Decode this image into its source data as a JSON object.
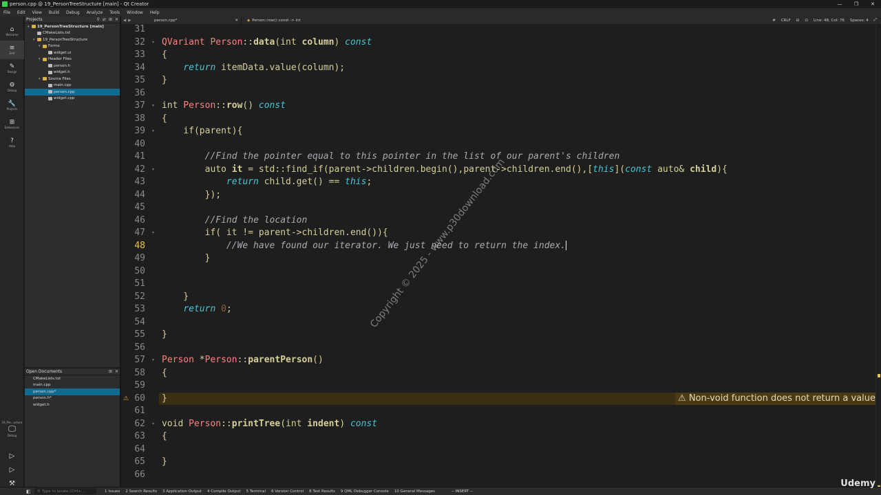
{
  "window": {
    "title": "person.cpp @ 19_PersonTreeStructure [main] - Qt Creator"
  },
  "menu": [
    "File",
    "Edit",
    "View",
    "Build",
    "Debug",
    "Analyze",
    "Tools",
    "Window",
    "Help"
  ],
  "modes": [
    {
      "label": "Welcome",
      "icon": "welcome-icon",
      "glyph": "⌂"
    },
    {
      "label": "Edit",
      "icon": "edit-icon",
      "glyph": "≡"
    },
    {
      "label": "Design",
      "icon": "design-icon",
      "glyph": "✎"
    },
    {
      "label": "Debug",
      "icon": "debug-icon",
      "glyph": "⚙"
    },
    {
      "label": "Projects",
      "icon": "projects-icon",
      "glyph": "🔧"
    },
    {
      "label": "Extensions",
      "icon": "extensions-icon",
      "glyph": "⊞"
    },
    {
      "label": "Help",
      "icon": "help-icon",
      "glyph": "?"
    }
  ],
  "kit": {
    "name": "19_Per...ucture",
    "mode": "Debug"
  },
  "projects_pane": {
    "title": "Projects",
    "items": [
      {
        "label": "19_PersonTreeStructure [main]",
        "indent": 0,
        "kind": "project",
        "bold": true
      },
      {
        "label": "CMakeLists.txt",
        "indent": 1,
        "kind": "file"
      },
      {
        "label": "19_PersonTreeStructure",
        "indent": 1,
        "kind": "folder"
      },
      {
        "label": "Forms",
        "indent": 2,
        "kind": "folder"
      },
      {
        "label": "widget.ui",
        "indent": 3,
        "kind": "file"
      },
      {
        "label": "Header Files",
        "indent": 2,
        "kind": "folder"
      },
      {
        "label": "person.h",
        "indent": 3,
        "kind": "file"
      },
      {
        "label": "widget.h",
        "indent": 3,
        "kind": "file"
      },
      {
        "label": "Source Files",
        "indent": 2,
        "kind": "folder"
      },
      {
        "label": "main.cpp",
        "indent": 3,
        "kind": "file"
      },
      {
        "label": "person.cpp",
        "indent": 3,
        "kind": "file",
        "selected": true
      },
      {
        "label": "widget.cpp",
        "indent": 3,
        "kind": "file"
      }
    ]
  },
  "open_documents": {
    "title": "Open Documents",
    "items": [
      {
        "label": "CMakeLists.txt"
      },
      {
        "label": "main.cpp"
      },
      {
        "label": "person.cpp*",
        "selected": true
      },
      {
        "label": "person.h*"
      },
      {
        "label": "widget.h"
      }
    ]
  },
  "editor_toolbar": {
    "file": "person.cpp*",
    "symbol": "Person::row() const -> int",
    "line_ending": "CRLF",
    "position": "Line: 48, Col: 76",
    "indent": "Spaces: 4"
  },
  "code": {
    "current_line": 48,
    "warning": {
      "line": 60,
      "text": "⚠ Non-void function does not return a value"
    },
    "lines": [
      {
        "n": 31,
        "html": ""
      },
      {
        "n": 32,
        "html": "<span class='ty'>QVariant</span> <span class='ty'>Person</span>::<span class='fn'>data</span>(<span class='kw'>int</span> <span class='bold'>column</span>) <span class='kwi'>const</span>"
      },
      {
        "n": 33,
        "html": "{"
      },
      {
        "n": 34,
        "html": "    <span class='kwi'>return</span> itemData.value(column);"
      },
      {
        "n": 35,
        "html": "}"
      },
      {
        "n": 36,
        "html": ""
      },
      {
        "n": 37,
        "html": "<span class='kw'>int</span> <span class='ty'>Person</span>::<span class='fn'>row</span>() <span class='kwi'>const</span>"
      },
      {
        "n": 38,
        "html": "{"
      },
      {
        "n": 39,
        "html": "    <span class='kw'>if</span>(parent){"
      },
      {
        "n": 40,
        "html": ""
      },
      {
        "n": 41,
        "html": "        <span class='cm'>//Find the pointer equal to this pointer in the list of our parent's children</span>"
      },
      {
        "n": 42,
        "html": "        <span class='kw'>auto</span> <span class='bold'>it</span> = std::find_if(parent-&gt;children.begin(),parent-&gt;children.end(),[<span class='kwi'>this</span>](<span class='kwi'>const</span> <span class='kw'>auto</span>&amp; <span class='bold'>child</span>){"
      },
      {
        "n": 43,
        "html": "            <span class='kwi'>return</span> child.get() == <span class='kwi'>this</span>;"
      },
      {
        "n": 44,
        "html": "        });"
      },
      {
        "n": 45,
        "html": ""
      },
      {
        "n": 46,
        "html": "        <span class='cm'>//Find the location</span>"
      },
      {
        "n": 47,
        "html": "        <span class='kw'>if</span>( it != parent-&gt;children.end()){"
      },
      {
        "n": 48,
        "html": "            <span class='cm'>//We have found our iterator. We just need to return the index.</span><span class='cursorbar'></span>"
      },
      {
        "n": 49,
        "html": "        }"
      },
      {
        "n": 50,
        "html": ""
      },
      {
        "n": 51,
        "html": ""
      },
      {
        "n": 52,
        "html": "    }"
      },
      {
        "n": 53,
        "html": "    <span class='kwi'>return</span> <span class='num'>0</span>;"
      },
      {
        "n": 54,
        "html": ""
      },
      {
        "n": 55,
        "html": "}"
      },
      {
        "n": 56,
        "html": ""
      },
      {
        "n": 57,
        "html": "<span class='ty'>Person</span> *<span class='ty'>Person</span>::<span class='fn'>parentPerson</span>()"
      },
      {
        "n": 58,
        "html": "{"
      },
      {
        "n": 59,
        "html": ""
      },
      {
        "n": 60,
        "html": "}"
      },
      {
        "n": 61,
        "html": ""
      },
      {
        "n": 62,
        "html": "<span class='kw'>void</span> <span class='ty'>Person</span>::<span class='fn'>printTree</span>(<span class='kw'>int</span> <span class='bold'>indent</span>) <span class='kwi'>const</span>"
      },
      {
        "n": 63,
        "html": "{"
      },
      {
        "n": 64,
        "html": ""
      },
      {
        "n": 65,
        "html": "}"
      },
      {
        "n": 66,
        "html": ""
      }
    ],
    "fold_lines": [
      32,
      37,
      39,
      42,
      47,
      57,
      62
    ]
  },
  "watermark": "Copyright © 2025 - www.p30download.com",
  "statusbar": {
    "locator_placeholder": "Type to locate (Ctrl+...",
    "tabs": [
      "1 Issues",
      "2 Search Results",
      "3 Application Output",
      "4 Compile Output",
      "5 Terminal",
      "6 Version Control",
      "8 Test Results",
      "9 QML Debugger Console",
      "10 General Messages"
    ],
    "mode": "-- INSERT --"
  },
  "brand": "Udemy"
}
